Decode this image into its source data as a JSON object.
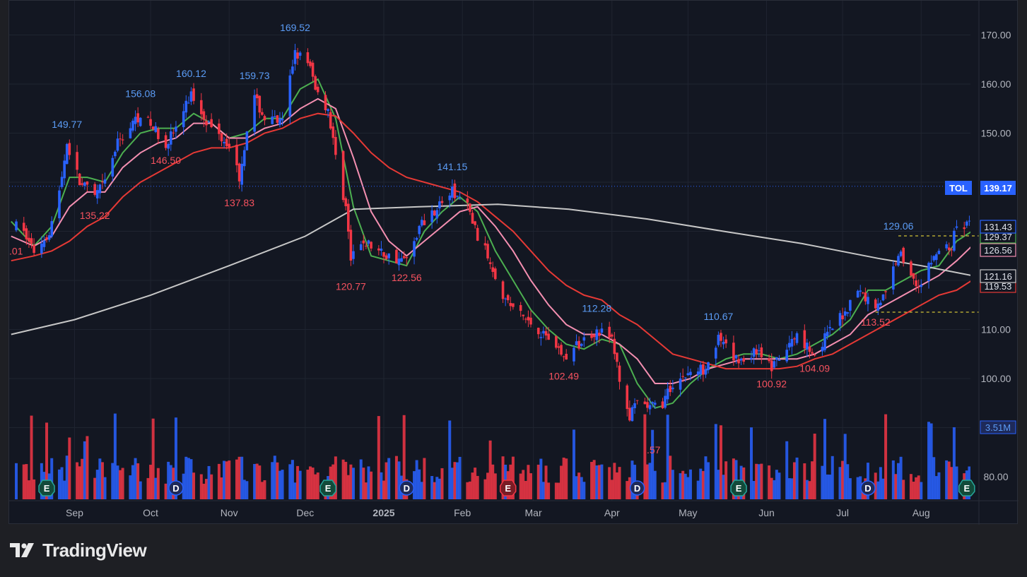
{
  "brand": {
    "name": "TradingView",
    "icon": "tradingview-logo-icon"
  },
  "colors": {
    "background": "#131722",
    "grid": "#1f2430",
    "up": "#2962ff",
    "down": "#f23645",
    "ma_green": "#4caf50",
    "ma_pink": "#f48fb1",
    "ma_red": "#e53935",
    "ma_gray": "#c7c7c7",
    "axis_text": "#b2b5be"
  },
  "chart_data": {
    "type": "candlestick",
    "symbol": "TOL",
    "last_price": "139.17",
    "x_tick_labels": [
      "Sep",
      "Oct",
      "Nov",
      "Dec",
      "2025",
      "Feb",
      "Mar",
      "Apr",
      "May",
      "Jun",
      "Jul",
      "Aug"
    ],
    "y_tick_labels": [
      "170.00",
      "160.00",
      "150.00",
      "110.00",
      "100.00",
      "80.00"
    ],
    "ylim": [
      88,
      174
    ],
    "grid": true,
    "price_labels": [
      {
        "text": "149.77",
        "date": "2024-08-29",
        "price": 149.77,
        "kind": "high"
      },
      {
        "text": "135.22",
        "date": "2024-09-09",
        "price": 135.22,
        "kind": "low"
      },
      {
        "text": "156.08",
        "date": "2024-09-27",
        "price": 156.08,
        "kind": "high"
      },
      {
        "text": "146.50",
        "date": "2024-10-07",
        "price": 146.5,
        "kind": "low"
      },
      {
        "text": "160.12",
        "date": "2024-10-17",
        "price": 160.12,
        "kind": "high"
      },
      {
        "text": "137.83",
        "date": "2024-11-05",
        "price": 137.83,
        "kind": "low"
      },
      {
        "text": "159.73",
        "date": "2024-11-11",
        "price": 159.73,
        "kind": "high"
      },
      {
        "text": "169.52",
        "date": "2024-11-27",
        "price": 169.52,
        "kind": "high"
      },
      {
        "text": "120.77",
        "date": "2024-12-19",
        "price": 120.77,
        "kind": "low"
      },
      {
        "text": "122.56",
        "date": "2025-01-10",
        "price": 122.56,
        "kind": "low"
      },
      {
        "text": "141.15",
        "date": "2025-01-28",
        "price": 141.15,
        "kind": "high"
      },
      {
        "text": "102.49",
        "date": "2025-03-13",
        "price": 102.49,
        "kind": "low"
      },
      {
        "text": "112.28",
        "date": "2025-03-26",
        "price": 112.28,
        "kind": "high"
      },
      {
        "text": "110.67",
        "date": "2025-05-13",
        "price": 110.67,
        "kind": "high"
      },
      {
        "text": "100.92",
        "date": "2025-06-03",
        "price": 100.92,
        "kind": "low"
      },
      {
        "text": "104.09",
        "date": "2025-06-20",
        "price": 104.09,
        "kind": "low"
      },
      {
        "text": "113.52",
        "date": "2025-07-14",
        "price": 113.52,
        "kind": "low"
      },
      {
        "text": "129.06",
        "date": "2025-07-23",
        "price": 129.06,
        "kind": "high"
      }
    ],
    "left_edge_label": ".01",
    "partial_low_label": ".57",
    "right_axis_badges": [
      {
        "text": "131.43",
        "price": 131.43,
        "color": "#2962ff",
        "style": "outline"
      },
      {
        "text": "129.37",
        "price": 129.37,
        "color": "#4caf50",
        "style": "outline"
      },
      {
        "text": "126.56",
        "price": 126.56,
        "color": "#f48fb1",
        "style": "outline"
      },
      {
        "text": "121.16",
        "price": 121.16,
        "color": "#c7c7c7",
        "style": "outline"
      },
      {
        "text": "119.53",
        "price": 119.53,
        "color": "#e53935",
        "style": "outline"
      }
    ],
    "volume_badge": "3.51M",
    "dashed_levels": [
      {
        "price": 129.06,
        "from": "2025-07-23",
        "color": "#ffeb3b"
      },
      {
        "price": 113.52,
        "from": "2025-07-14",
        "color": "#ffeb3b"
      }
    ],
    "event_markers": [
      {
        "letter": "E",
        "date": "2024-08-21",
        "kind": "earnings"
      },
      {
        "letter": "D",
        "date": "2024-10-11",
        "kind": "dividend"
      },
      {
        "letter": "E",
        "date": "2024-12-10",
        "kind": "earnings"
      },
      {
        "letter": "D",
        "date": "2025-01-10",
        "kind": "dividend"
      },
      {
        "letter": "E",
        "date": "2025-02-19",
        "kind": "earnings-down"
      },
      {
        "letter": "D",
        "date": "2025-04-11",
        "kind": "dividend"
      },
      {
        "letter": "E",
        "date": "2025-05-21",
        "kind": "earnings"
      },
      {
        "letter": "D",
        "date": "2025-07-11",
        "kind": "dividend"
      },
      {
        "letter": "E",
        "date": "2025-08-19",
        "kind": "earnings"
      }
    ],
    "moving_averages": [
      {
        "color": "#4caf50",
        "points": [
          [
            "2024-08-07",
            132
          ],
          [
            "2024-08-16",
            127
          ],
          [
            "2024-08-23",
            131
          ],
          [
            "2024-08-30",
            141
          ],
          [
            "2024-09-06",
            141
          ],
          [
            "2024-09-13",
            140
          ],
          [
            "2024-09-20",
            146
          ],
          [
            "2024-09-27",
            150
          ],
          [
            "2024-10-04",
            151
          ],
          [
            "2024-10-11",
            151
          ],
          [
            "2024-10-18",
            154
          ],
          [
            "2024-10-25",
            152
          ],
          [
            "2024-11-01",
            149
          ],
          [
            "2024-11-08",
            150
          ],
          [
            "2024-11-15",
            153
          ],
          [
            "2024-11-22",
            153
          ],
          [
            "2024-11-29",
            159
          ],
          [
            "2024-12-06",
            161
          ],
          [
            "2024-12-13",
            153
          ],
          [
            "2024-12-20",
            135
          ],
          [
            "2024-12-27",
            125
          ],
          [
            "2025-01-03",
            124
          ],
          [
            "2025-01-10",
            123
          ],
          [
            "2025-01-17",
            130
          ],
          [
            "2025-01-24",
            134
          ],
          [
            "2025-01-31",
            137
          ],
          [
            "2025-02-07",
            134
          ],
          [
            "2025-02-14",
            126
          ],
          [
            "2025-02-21",
            120
          ],
          [
            "2025-02-28",
            114
          ],
          [
            "2025-03-07",
            110
          ],
          [
            "2025-03-14",
            107
          ],
          [
            "2025-03-21",
            106
          ],
          [
            "2025-03-28",
            108
          ],
          [
            "2025-04-04",
            107
          ],
          [
            "2025-04-11",
            99
          ],
          [
            "2025-04-18",
            94
          ],
          [
            "2025-04-25",
            95
          ],
          [
            "2025-05-02",
            99
          ],
          [
            "2025-05-09",
            102
          ],
          [
            "2025-05-16",
            104
          ],
          [
            "2025-05-23",
            105
          ],
          [
            "2025-05-30",
            105
          ],
          [
            "2025-06-06",
            104
          ],
          [
            "2025-06-13",
            105
          ],
          [
            "2025-06-20",
            107
          ],
          [
            "2025-06-27",
            109
          ],
          [
            "2025-07-04",
            112
          ],
          [
            "2025-07-11",
            118
          ],
          [
            "2025-07-18",
            118
          ],
          [
            "2025-07-25",
            120
          ],
          [
            "2025-08-01",
            122
          ],
          [
            "2025-08-08",
            123
          ],
          [
            "2025-08-15",
            128
          ],
          [
            "2025-08-21",
            130
          ]
        ]
      },
      {
        "color": "#f48fb1",
        "points": [
          [
            "2024-08-07",
            129
          ],
          [
            "2024-08-16",
            127
          ],
          [
            "2024-08-23",
            129
          ],
          [
            "2024-08-30",
            135
          ],
          [
            "2024-09-06",
            138
          ],
          [
            "2024-09-13",
            138
          ],
          [
            "2024-09-20",
            143
          ],
          [
            "2024-09-27",
            146
          ],
          [
            "2024-10-04",
            148
          ],
          [
            "2024-10-11",
            149
          ],
          [
            "2024-10-18",
            152
          ],
          [
            "2024-10-25",
            152
          ],
          [
            "2024-11-01",
            149
          ],
          [
            "2024-11-08",
            149
          ],
          [
            "2024-11-15",
            151
          ],
          [
            "2024-11-22",
            152
          ],
          [
            "2024-11-29",
            155
          ],
          [
            "2024-12-06",
            157
          ],
          [
            "2024-12-13",
            155
          ],
          [
            "2024-12-20",
            145
          ],
          [
            "2024-12-27",
            134
          ],
          [
            "2025-01-03",
            128
          ],
          [
            "2025-01-10",
            125
          ],
          [
            "2025-01-17",
            128
          ],
          [
            "2025-01-24",
            131
          ],
          [
            "2025-01-31",
            134
          ],
          [
            "2025-02-07",
            135
          ],
          [
            "2025-02-14",
            131
          ],
          [
            "2025-02-21",
            126
          ],
          [
            "2025-02-28",
            120
          ],
          [
            "2025-03-07",
            115
          ],
          [
            "2025-03-14",
            111
          ],
          [
            "2025-03-21",
            109
          ],
          [
            "2025-03-28",
            109
          ],
          [
            "2025-04-04",
            107
          ],
          [
            "2025-04-11",
            104
          ],
          [
            "2025-04-18",
            99
          ],
          [
            "2025-04-25",
            99
          ],
          [
            "2025-05-02",
            100
          ],
          [
            "2025-05-09",
            102
          ],
          [
            "2025-05-16",
            103
          ],
          [
            "2025-05-23",
            104
          ],
          [
            "2025-05-30",
            104
          ],
          [
            "2025-06-06",
            104
          ],
          [
            "2025-06-13",
            104
          ],
          [
            "2025-06-20",
            105
          ],
          [
            "2025-06-27",
            107
          ],
          [
            "2025-07-04",
            109
          ],
          [
            "2025-07-11",
            113
          ],
          [
            "2025-07-18",
            115
          ],
          [
            "2025-07-25",
            117
          ],
          [
            "2025-08-01",
            119
          ],
          [
            "2025-08-08",
            121
          ],
          [
            "2025-08-15",
            124
          ],
          [
            "2025-08-21",
            127
          ]
        ]
      },
      {
        "color": "#e53935",
        "points": [
          [
            "2024-08-07",
            124
          ],
          [
            "2024-08-16",
            125
          ],
          [
            "2024-08-23",
            126
          ],
          [
            "2024-08-30",
            128
          ],
          [
            "2024-09-06",
            131
          ],
          [
            "2024-09-13",
            133
          ],
          [
            "2024-09-20",
            137
          ],
          [
            "2024-09-27",
            140
          ],
          [
            "2024-10-04",
            142
          ],
          [
            "2024-10-11",
            144
          ],
          [
            "2024-10-18",
            146
          ],
          [
            "2024-10-25",
            147
          ],
          [
            "2024-11-01",
            147
          ],
          [
            "2024-11-08",
            148
          ],
          [
            "2024-11-15",
            150
          ],
          [
            "2024-11-22",
            151
          ],
          [
            "2024-11-29",
            153
          ],
          [
            "2024-12-06",
            154
          ],
          [
            "2024-12-13",
            153.5
          ],
          [
            "2024-12-20",
            150
          ],
          [
            "2024-12-27",
            146
          ],
          [
            "2025-01-03",
            143
          ],
          [
            "2025-01-10",
            141
          ],
          [
            "2025-01-17",
            140
          ],
          [
            "2025-01-24",
            139
          ],
          [
            "2025-01-31",
            138
          ],
          [
            "2025-02-07",
            136
          ],
          [
            "2025-02-14",
            133
          ],
          [
            "2025-02-21",
            130
          ],
          [
            "2025-02-28",
            126
          ],
          [
            "2025-03-07",
            122
          ],
          [
            "2025-03-14",
            119
          ],
          [
            "2025-03-21",
            117
          ],
          [
            "2025-03-28",
            116
          ],
          [
            "2025-04-04",
            113
          ],
          [
            "2025-04-11",
            111
          ],
          [
            "2025-04-18",
            108
          ],
          [
            "2025-04-25",
            105
          ],
          [
            "2025-05-02",
            104
          ],
          [
            "2025-05-09",
            103
          ],
          [
            "2025-05-16",
            102
          ],
          [
            "2025-05-23",
            102
          ],
          [
            "2025-05-30",
            102
          ],
          [
            "2025-06-06",
            102
          ],
          [
            "2025-06-13",
            102.5
          ],
          [
            "2025-06-20",
            104
          ],
          [
            "2025-06-27",
            105
          ],
          [
            "2025-07-04",
            107
          ],
          [
            "2025-07-11",
            109
          ],
          [
            "2025-07-18",
            111
          ],
          [
            "2025-07-25",
            113
          ],
          [
            "2025-08-01",
            115
          ],
          [
            "2025-08-08",
            117
          ],
          [
            "2025-08-15",
            118
          ],
          [
            "2025-08-21",
            120
          ]
        ]
      },
      {
        "color": "#c7c7c7",
        "points": [
          [
            "2024-08-07",
            109
          ],
          [
            "2024-09-01",
            112
          ],
          [
            "2024-10-01",
            117
          ],
          [
            "2024-11-01",
            123
          ],
          [
            "2024-12-01",
            129
          ],
          [
            "2024-12-20",
            134.5
          ],
          [
            "2025-01-15",
            135
          ],
          [
            "2025-02-15",
            135.5
          ],
          [
            "2025-03-15",
            134.5
          ],
          [
            "2025-04-15",
            132.5
          ],
          [
            "2025-05-15",
            130
          ],
          [
            "2025-06-15",
            127.5
          ],
          [
            "2025-07-15",
            124.5
          ],
          [
            "2025-08-01",
            123
          ],
          [
            "2025-08-21",
            121
          ]
        ]
      }
    ]
  }
}
